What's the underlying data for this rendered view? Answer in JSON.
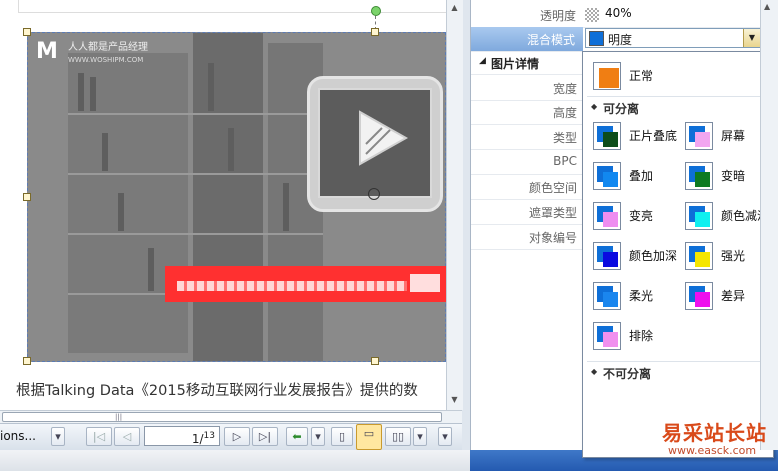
{
  "document": {
    "image_logo": {
      "mark": "M",
      "name": "人人都是产品经理",
      "url": "WWW.WOSHIPM.COM"
    },
    "tablet_text": "(f+n)²\n(f+n)²",
    "caption": "根据Talking Data《2015移动互联网行业发展报告》提供的数"
  },
  "toolbar": {
    "options_label": "ions...",
    "page_current": "1",
    "page_total": "13",
    "page_separator": "/"
  },
  "properties": {
    "transparency": {
      "label": "透明度",
      "value": "40%"
    },
    "blend_mode": {
      "label": "混合模式",
      "value": "明度"
    },
    "section_title": "图片详情",
    "rows": [
      {
        "label": "宽度"
      },
      {
        "label": "高度"
      },
      {
        "label": "类型"
      },
      {
        "label": "BPC"
      },
      {
        "label": "颜色空间"
      },
      {
        "label": "遮罩类型"
      },
      {
        "label": "对象编号"
      }
    ]
  },
  "blend_menu": {
    "normal": {
      "label": "正常",
      "bottom": "#ffffff",
      "top": "#f07e13"
    },
    "group_separable": "可分离",
    "separable": [
      {
        "label": "正片叠底",
        "bottom": "#0e6fd8",
        "top": "#0d4d1a"
      },
      {
        "label": "屏幕",
        "bottom": "#0e6fd8",
        "top": "#f2a6f0"
      },
      {
        "label": "叠加",
        "bottom": "#0e6fd8",
        "top": "#1188f0"
      },
      {
        "label": "变暗",
        "bottom": "#0e6fd8",
        "top": "#0d7a22"
      },
      {
        "label": "变亮",
        "bottom": "#0e6fd8",
        "top": "#ee8ef0"
      },
      {
        "label": "颜色减淡",
        "bottom": "#0e6fd8",
        "top": "#0ff0f0"
      },
      {
        "label": "颜色加深",
        "bottom": "#0e6fd8",
        "top": "#0a0ae0"
      },
      {
        "label": "强光",
        "bottom": "#0e6fd8",
        "top": "#f5e600"
      },
      {
        "label": "柔光",
        "bottom": "#0e6fd8",
        "top": "#1a86ee"
      },
      {
        "label": "差异",
        "bottom": "#0e6fd8",
        "top": "#ee10ee"
      },
      {
        "label": "排除",
        "bottom": "#0e6fd8",
        "top": "#f090ee"
      }
    ],
    "group_nonseparable": "不可分离"
  },
  "watermark": {
    "main": "易采站长站",
    "sub": "www.easck.com"
  },
  "colors": {
    "selection_blue": "#7fa9dd",
    "red_band": "#ff3030",
    "watermark": "#d94a1a"
  }
}
